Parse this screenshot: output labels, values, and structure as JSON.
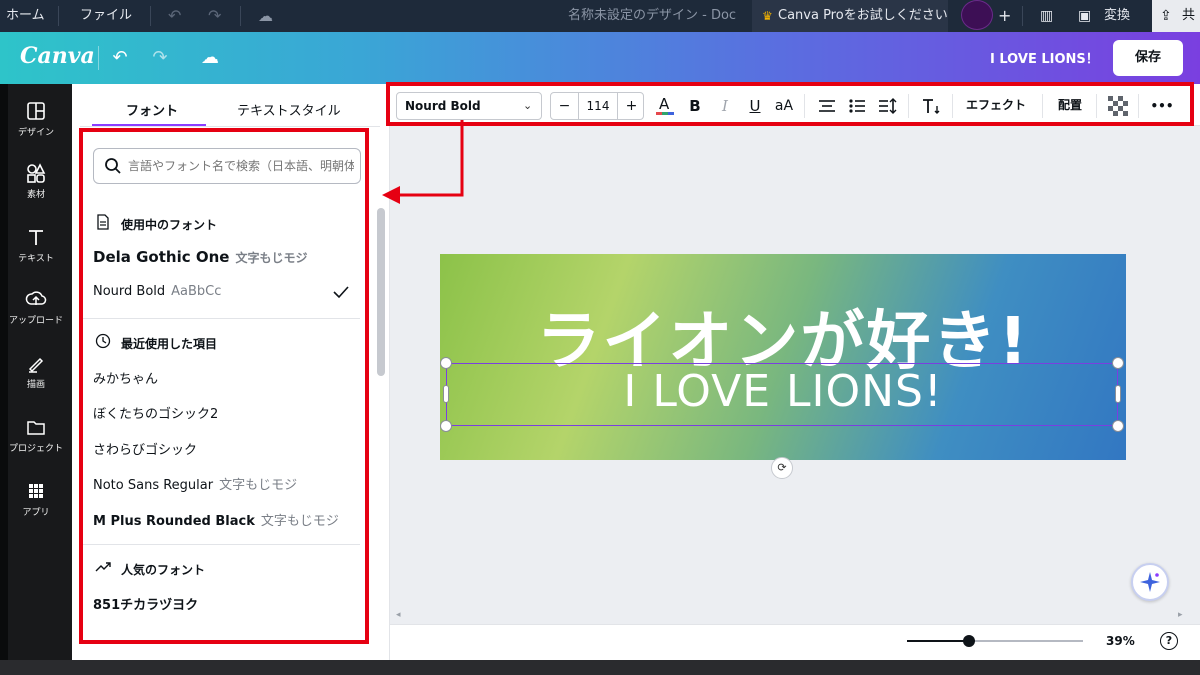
{
  "os_bar": {
    "home": "ホーム",
    "file": "ファイル",
    "doc_title": "名称未設定のデザイン - Doc",
    "pro_trial": "Canva Proをお試しください",
    "convert": "変換",
    "share": "共"
  },
  "header": {
    "logo": "Canva",
    "doc_title": "I LOVE LIONS！",
    "save": "保存"
  },
  "rail": {
    "items": [
      {
        "label": "デザイン",
        "icon": "layout-icon"
      },
      {
        "label": "素材",
        "icon": "elements-icon"
      },
      {
        "label": "テキスト",
        "icon": "text-icon"
      },
      {
        "label": "アップロード",
        "icon": "upload-icon"
      },
      {
        "label": "描画",
        "icon": "draw-icon"
      },
      {
        "label": "プロジェクト",
        "icon": "folder-icon"
      },
      {
        "label": "アプリ",
        "icon": "apps-icon"
      }
    ]
  },
  "panel": {
    "tabs": [
      "フォント",
      "テキストスタイル"
    ],
    "active_tab": 0,
    "search_placeholder": "言語やフォント名で検索（日本語、明朝体",
    "sections": {
      "in_use": "使用中のフォント",
      "recent": "最近使用した項目",
      "popular": "人気のフォント"
    },
    "in_use_fonts": [
      {
        "name": "Dela Gothic One",
        "sample": "文字もじモジ"
      },
      {
        "name": "Nourd Bold",
        "sample": "AaBbCc",
        "selected": true
      }
    ],
    "recent_fonts": [
      {
        "name": "みかちゃん",
        "sample": ""
      },
      {
        "name": "ぼくたちのゴシック2",
        "sample": ""
      },
      {
        "name": "さわらびゴシック",
        "sample": ""
      },
      {
        "name": "Noto Sans Regular",
        "sample": "文字もじモジ"
      },
      {
        "name": "M Plus Rounded Black",
        "sample": "文字もじモジ"
      }
    ],
    "popular_fonts": [
      {
        "name": "851チカラヅヨク",
        "sample": ""
      }
    ]
  },
  "toolbar": {
    "font": "Nourd Bold",
    "font_size": "114",
    "minus": "−",
    "plus": "+",
    "bold": "B",
    "italic": "I",
    "underline": "U",
    "case": "aA",
    "effects": "エフェクト",
    "position": "配置",
    "more": "•••"
  },
  "canvas": {
    "heading_jp": "ライオンが好き!",
    "heading_en": "I LOVE LIONS!"
  },
  "bottom": {
    "zoom": "39%",
    "zoom_fraction": 0.35,
    "help": "?"
  },
  "colors": {
    "highlight_red": "#e60012",
    "accent_purple": "#8b3dff"
  }
}
